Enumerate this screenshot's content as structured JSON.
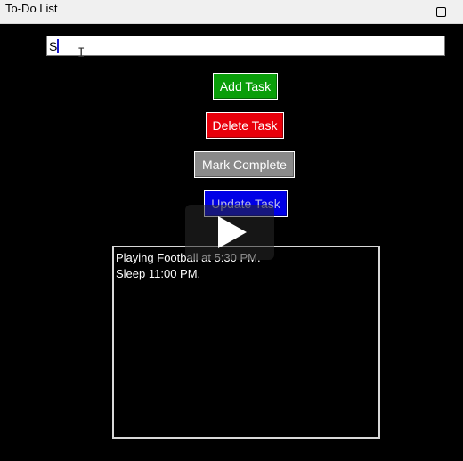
{
  "window": {
    "title": "To-Do List",
    "minimize_icon": "minimize-icon",
    "maximize_icon": "maximize-icon"
  },
  "input": {
    "value": "S"
  },
  "buttons": {
    "add_label": "Add Task",
    "delete_label": "Delete Task",
    "complete_label": "Mark Complete",
    "update_label": "Update Task"
  },
  "tasks": [
    "Playing Football at 5:30 PM.",
    "Sleep 11:00 PM."
  ],
  "colors": {
    "add": "#0a9e0a",
    "delete": "#e8000b",
    "complete": "#8a8a8a",
    "update": "#0000e6",
    "background": "#000000"
  },
  "overlay": {
    "icon": "play-icon"
  }
}
